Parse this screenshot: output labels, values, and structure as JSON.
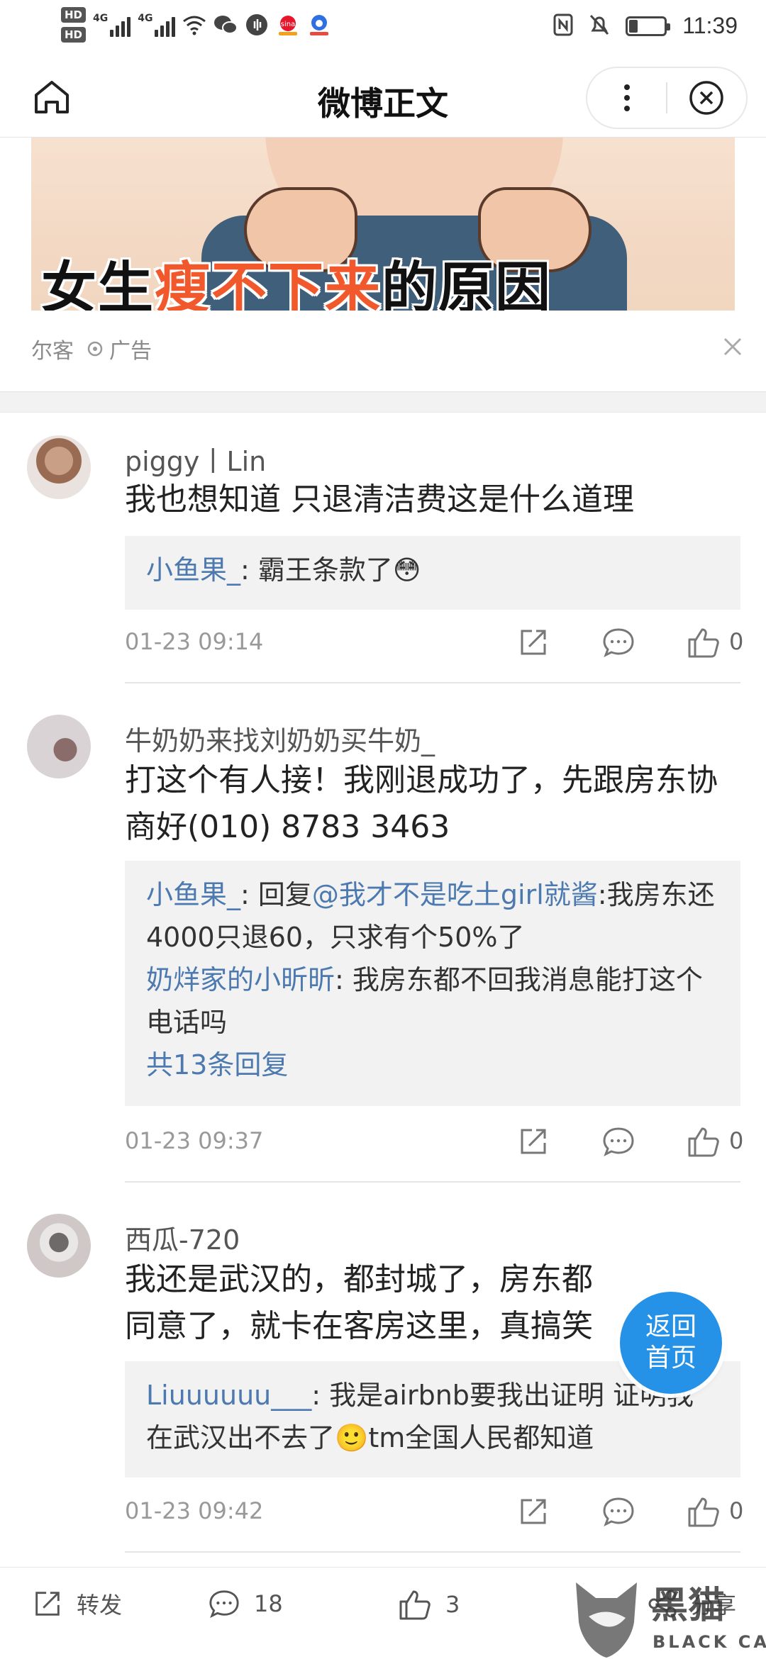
{
  "status_bar": {
    "hd1": "HD",
    "hd2": "HD",
    "net1": "4G",
    "net2": "4G",
    "time": "11:39",
    "battery_level": 0.25
  },
  "nav": {
    "title": "微博正文"
  },
  "ad": {
    "headline_part1": "女生",
    "headline_highlight": "瘦不下来",
    "headline_part2": "的原因",
    "source": "尔客",
    "label": "广告"
  },
  "comments": [
    {
      "username": "piggy丨Lin",
      "text": "我也想知道 只退清洁费这是什么道理",
      "replies": [
        {
          "name": "小鱼果_",
          "text": ": 霸王条款了😳"
        }
      ],
      "more_replies": "",
      "time": "01-23 09:14",
      "likes": "0"
    },
    {
      "username": "牛奶奶来找刘奶奶买牛奶_",
      "text": "打这个有人接！我刚退成功了，先跟房东协商好(010) 8783 3463",
      "replies": [
        {
          "name": "小鱼果_",
          "text": ": 回复",
          "mention": "@我才不是吃土girl就酱",
          "text2": ":我房东还4000只退60，只求有个50%了"
        },
        {
          "name": "奶烊家的小昕昕",
          "text": ": 我房东都不回我消息能打这个电话吗"
        }
      ],
      "more_replies": "共13条回复",
      "time": "01-23 09:37",
      "likes": "0"
    },
    {
      "username": "西瓜-720",
      "text": "我还是武汉的，都封城了，房东都同意了，就卡在客房这里，真搞笑",
      "replies": [
        {
          "name": "Liuuuuuu___",
          "text": ": 我是airbnb要我出证明 证明我在武汉出不去了🙂tm全国人民都知道"
        }
      ],
      "more_replies": "",
      "time": "01-23 09:42",
      "likes": "0"
    }
  ],
  "float_button": {
    "line1": "返回",
    "line2": "首页"
  },
  "toolbar": {
    "repost_label": "转发",
    "comment_count": "18",
    "like_count": "3",
    "share_label": "分享"
  },
  "watermark": {
    "text": "黑猫",
    "sub": "BLACK CAT"
  },
  "colors": {
    "link_blue": "#4c7ab0",
    "float_blue": "#2592e8",
    "ad_highlight": "#f1582b"
  }
}
